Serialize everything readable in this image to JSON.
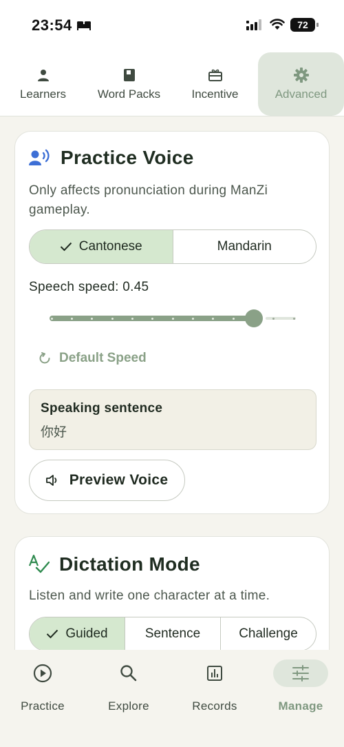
{
  "status_bar": {
    "time": "23:54",
    "battery": "72"
  },
  "top_tabs": [
    {
      "label": "Learners",
      "icon": "person-icon"
    },
    {
      "label": "Word Packs",
      "icon": "book-icon"
    },
    {
      "label": "Incentive",
      "icon": "gift-icon"
    },
    {
      "label": "Advanced",
      "icon": "gear-icon",
      "active": true
    }
  ],
  "practice_voice": {
    "title": "Practice Voice",
    "description": "Only affects pronunciation during ManZi gameplay.",
    "options": [
      "Cantonese",
      "Mandarin"
    ],
    "selected": "Cantonese",
    "speed_label": "Speech speed: 0.45",
    "speed_fraction": 0.83,
    "default_speed_label": "Default Speed",
    "sentence_label": "Speaking sentence",
    "sentence_value": "你好",
    "preview_label": "Preview Voice"
  },
  "dictation_mode": {
    "title": "Dictation Mode",
    "description": "Listen and write one character at a time.",
    "options": [
      "Guided",
      "Sentence",
      "Challenge"
    ],
    "selected": "Guided"
  },
  "bottom_nav": [
    {
      "label": "Practice",
      "icon": "play-circle-icon"
    },
    {
      "label": "Explore",
      "icon": "search-icon"
    },
    {
      "label": "Records",
      "icon": "bar-chart-icon"
    },
    {
      "label": "Manage",
      "icon": "sliders-icon",
      "active": true
    }
  ],
  "colors": {
    "accent": "#8aa187",
    "selected_bg": "#d5e8cf",
    "active_tab_bg": "#dfe6dc",
    "voice_icon": "#3d6fd6",
    "dictation_icon": "#2e8a4e"
  }
}
